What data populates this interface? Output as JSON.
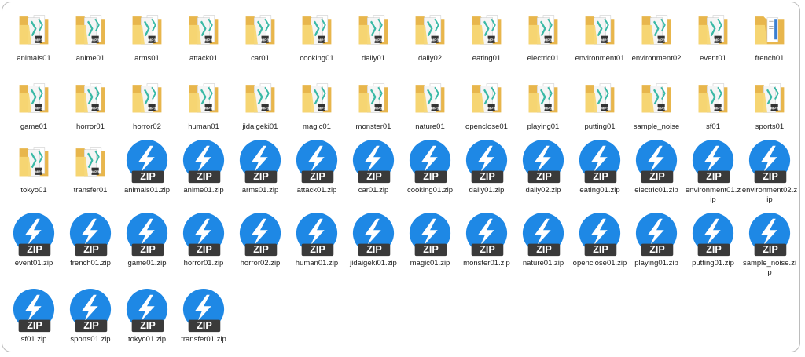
{
  "items": [
    {
      "label": "animals01",
      "type": "folder-mp3"
    },
    {
      "label": "anime01",
      "type": "folder-mp3"
    },
    {
      "label": "arms01",
      "type": "folder-mp3"
    },
    {
      "label": "attack01",
      "type": "folder-mp3"
    },
    {
      "label": "car01",
      "type": "folder-mp3"
    },
    {
      "label": "cooking01",
      "type": "folder-mp3"
    },
    {
      "label": "daily01",
      "type": "folder-mp3"
    },
    {
      "label": "daily02",
      "type": "folder-mp3"
    },
    {
      "label": "eating01",
      "type": "folder-mp3"
    },
    {
      "label": "electric01",
      "type": "folder-mp3"
    },
    {
      "label": "environment01",
      "type": "folder-mp3"
    },
    {
      "label": "environment02",
      "type": "folder-mp3"
    },
    {
      "label": "event01",
      "type": "folder-mp3"
    },
    {
      "label": "french01",
      "type": "folder-doc"
    },
    {
      "label": "game01",
      "type": "folder-mp3"
    },
    {
      "label": "horror01",
      "type": "folder-mp3"
    },
    {
      "label": "horror02",
      "type": "folder-mp3"
    },
    {
      "label": "human01",
      "type": "folder-mp3"
    },
    {
      "label": "jidaigeki01",
      "type": "folder-mp3"
    },
    {
      "label": "magic01",
      "type": "folder-mp3"
    },
    {
      "label": "monster01",
      "type": "folder-mp3"
    },
    {
      "label": "nature01",
      "type": "folder-mp3"
    },
    {
      "label": "openclose01",
      "type": "folder-mp3"
    },
    {
      "label": "playing01",
      "type": "folder-mp3"
    },
    {
      "label": "putting01",
      "type": "folder-mp3"
    },
    {
      "label": "sample_noise",
      "type": "folder-mp3"
    },
    {
      "label": "sf01",
      "type": "folder-mp3"
    },
    {
      "label": "sports01",
      "type": "folder-mp3"
    },
    {
      "label": "tokyo01",
      "type": "folder-mp3"
    },
    {
      "label": "transfer01",
      "type": "folder-mp3"
    },
    {
      "label": "animals01.zip",
      "type": "zip"
    },
    {
      "label": "anime01.zip",
      "type": "zip"
    },
    {
      "label": "arms01.zip",
      "type": "zip"
    },
    {
      "label": "attack01.zip",
      "type": "zip"
    },
    {
      "label": "car01.zip",
      "type": "zip"
    },
    {
      "label": "cooking01.zip",
      "type": "zip"
    },
    {
      "label": "daily01.zip",
      "type": "zip"
    },
    {
      "label": "daily02.zip",
      "type": "zip"
    },
    {
      "label": "eating01.zip",
      "type": "zip"
    },
    {
      "label": "electric01.zip",
      "type": "zip"
    },
    {
      "label": "environment01.zip",
      "type": "zip"
    },
    {
      "label": "environment02.zip",
      "type": "zip"
    },
    {
      "label": "event01.zip",
      "type": "zip"
    },
    {
      "label": "french01.zip",
      "type": "zip"
    },
    {
      "label": "game01.zip",
      "type": "zip"
    },
    {
      "label": "horror01.zip",
      "type": "zip"
    },
    {
      "label": "horror02.zip",
      "type": "zip"
    },
    {
      "label": "human01.zip",
      "type": "zip"
    },
    {
      "label": "jidaigeki01.zip",
      "type": "zip"
    },
    {
      "label": "magic01.zip",
      "type": "zip"
    },
    {
      "label": "monster01.zip",
      "type": "zip"
    },
    {
      "label": "nature01.zip",
      "type": "zip"
    },
    {
      "label": "openclose01.zip",
      "type": "zip"
    },
    {
      "label": "playing01.zip",
      "type": "zip"
    },
    {
      "label": "putting01.zip",
      "type": "zip"
    },
    {
      "label": "sample_noise.zip",
      "type": "zip"
    },
    {
      "label": "sf01.zip",
      "type": "zip"
    },
    {
      "label": "sports01.zip",
      "type": "zip"
    },
    {
      "label": "tokyo01.zip",
      "type": "zip"
    },
    {
      "label": "transfer01.zip",
      "type": "zip"
    }
  ],
  "badges": {
    "mp3": "MP3",
    "zip": "ZIP"
  },
  "colors": {
    "folder_back": "#e8b64c",
    "folder_front": "#f7d774",
    "paper": "#f5f5f5",
    "teal": "#3ab9a6",
    "zip_blue": "#1e88e5",
    "zip_badge": "#3a3a3a"
  }
}
